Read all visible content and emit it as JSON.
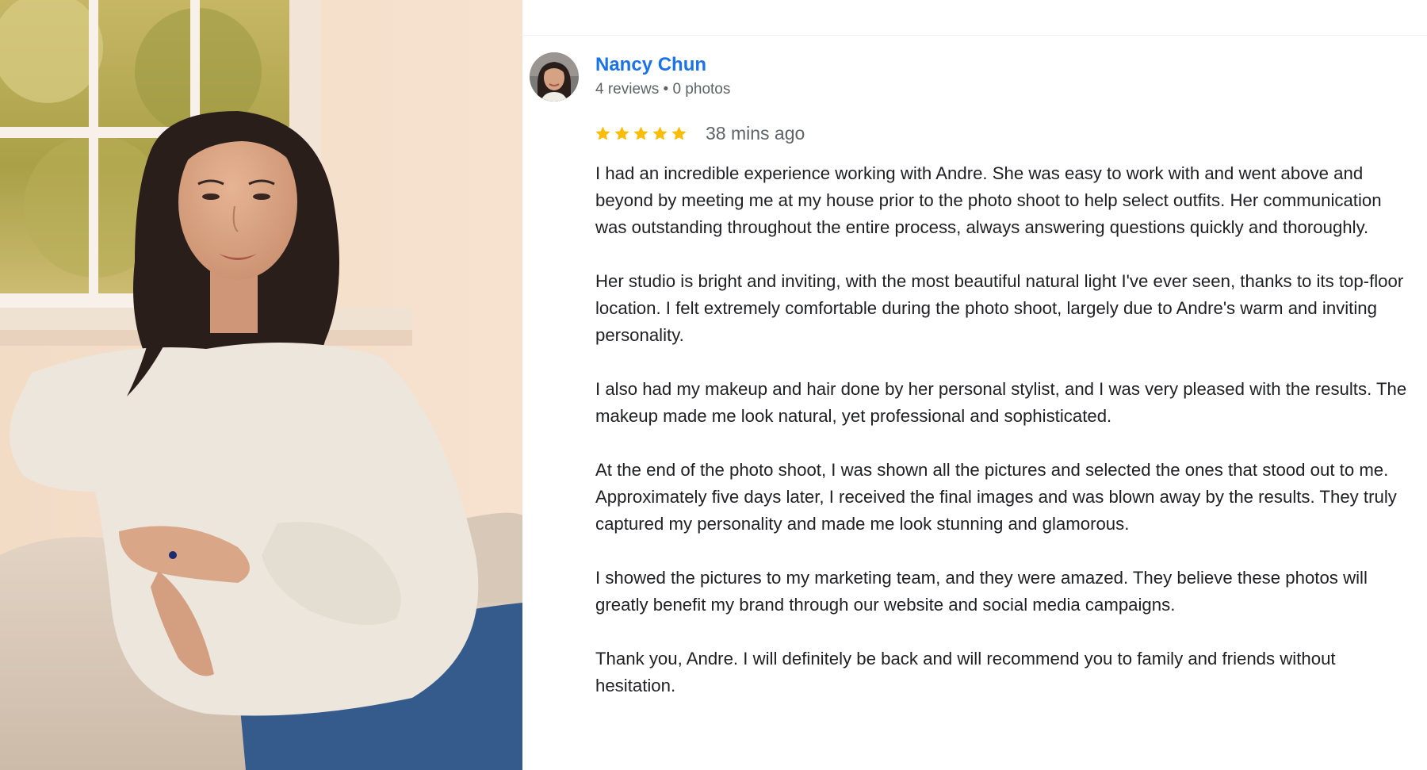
{
  "reviewer": {
    "name": "Nancy Chun",
    "meta": "4 reviews • 0 photos",
    "avatar_icon": "user-avatar"
  },
  "rating": {
    "stars": 5,
    "max_stars": 5,
    "star_color": "#fbbc04",
    "time": "38 mins ago"
  },
  "review": {
    "paragraphs": [
      "I had an incredible experience working with Andre. She was easy to work with and went above and beyond by meeting me at my house prior to the photo shoot to help select outfits. Her communication was outstanding throughout the entire process, always answering questions quickly and thoroughly.",
      "Her studio is bright and inviting, with the most beautiful natural light I've ever seen, thanks to its top-floor location. I felt extremely comfortable during the photo shoot, largely due to Andre's warm and inviting personality.",
      "I also had my makeup and hair done by her personal stylist, and I was very pleased with the results. The makeup made me look natural, yet professional and sophisticated.",
      "At the end of the photo shoot, I was shown all the pictures and selected the ones that stood out to me. Approximately five days later, I received the final images and was blown away by the results. They truly captured my personality and made me look stunning and glamorous.",
      "I showed the pictures to my marketing team, and they were amazed. They believe these photos will greatly benefit my brand through our website and social media campaigns.",
      "Thank you, Andre. I will definitely be back and will recommend you to family and friends without hesitation."
    ]
  },
  "colors": {
    "name_link": "#1a73e8",
    "meta_text": "#5f6368",
    "body_text": "#202124"
  }
}
